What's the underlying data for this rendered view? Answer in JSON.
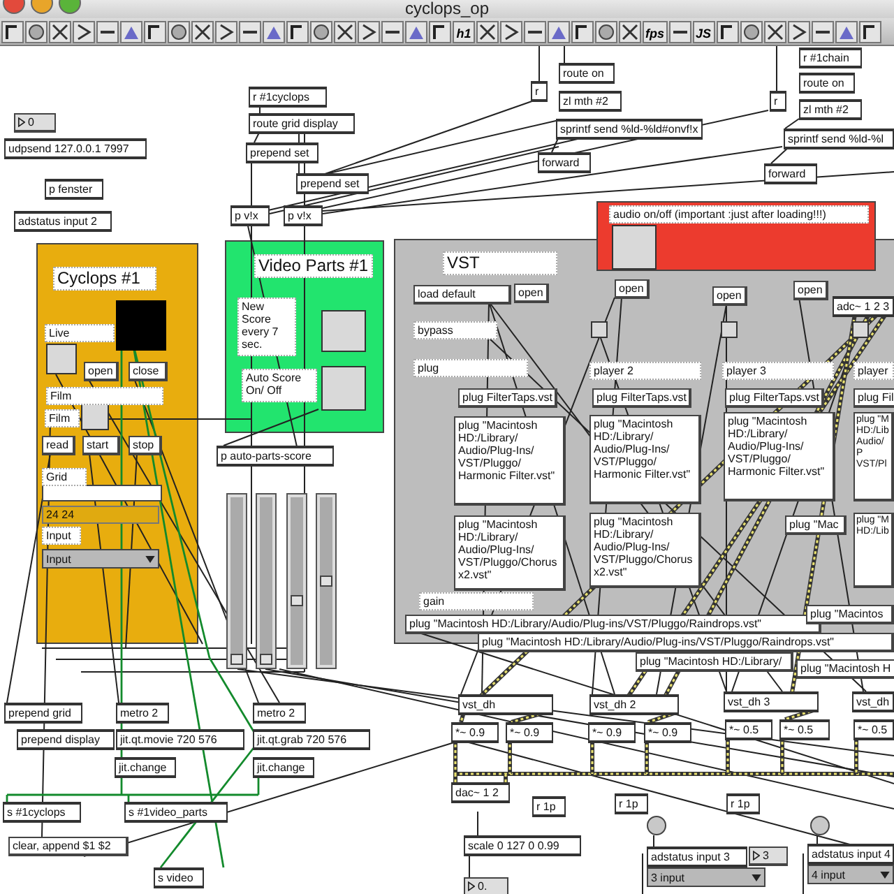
{
  "window": {
    "title": "cyclops_op"
  },
  "toolbar": {
    "labels": [
      "h1",
      "fps",
      "JS"
    ]
  },
  "panels": [
    {
      "color": "#e8ad0e"
    },
    {
      "color": "#22e46e"
    },
    {
      "color": "#bdbdbd"
    },
    {
      "color": "#ec3b2e"
    }
  ],
  "sliders": [
    {
      "level": 0.02
    },
    {
      "level": 0.02
    },
    {
      "level": 0.38
    },
    {
      "level": 0.5
    }
  ],
  "boxes": [
    {
      "kind": "number",
      "text": "0"
    },
    {
      "kind": "object",
      "text": "udpsend 127.0.0.1 7997"
    },
    {
      "kind": "object",
      "text": "p fenster"
    },
    {
      "kind": "object",
      "text": "adstatus input 2"
    },
    {
      "kind": "object",
      "text": "r #1cyclops"
    },
    {
      "kind": "object",
      "text": "route grid display"
    },
    {
      "kind": "object",
      "text": "prepend set"
    },
    {
      "kind": "object",
      "text": "prepend set"
    },
    {
      "kind": "object",
      "text": "p v!x"
    },
    {
      "kind": "object",
      "text": "p v!x"
    },
    {
      "kind": "object",
      "text": "route on"
    },
    {
      "kind": "object",
      "text": "r"
    },
    {
      "kind": "object",
      "text": "zl mth #2"
    },
    {
      "kind": "object",
      "text": "sprintf send %ld-%ld#onvf!x"
    },
    {
      "kind": "object",
      "text": "forward"
    },
    {
      "kind": "object",
      "text": "r"
    },
    {
      "kind": "object",
      "text": "r #1chain"
    },
    {
      "kind": "object",
      "text": "route on"
    },
    {
      "kind": "object",
      "text": "zl mth #2"
    },
    {
      "kind": "object",
      "text": "sprintf send %ld-%l"
    },
    {
      "kind": "object",
      "text": "forward"
    },
    {
      "kind": "comment",
      "text": "audio on/off (important :just after loading!!!)"
    },
    {
      "kind": "comment",
      "text": "Cyclops #1"
    },
    {
      "kind": "comment",
      "text": "Live"
    },
    {
      "kind": "message",
      "text": "open"
    },
    {
      "kind": "message",
      "text": "close"
    },
    {
      "kind": "comment",
      "text": "Film"
    },
    {
      "kind": "comment",
      "text": "Film"
    },
    {
      "kind": "message",
      "text": "read"
    },
    {
      "kind": "message",
      "text": "start"
    },
    {
      "kind": "message",
      "text": "stop"
    },
    {
      "kind": "comment",
      "text": "Grid"
    },
    {
      "kind": "display",
      "text": "24 24"
    },
    {
      "kind": "comment",
      "text": "Input"
    },
    {
      "kind": "menu",
      "text": "Input"
    },
    {
      "kind": "comment",
      "text": "Video Parts #1"
    },
    {
      "kind": "comment",
      "text": "New Score every 7 sec."
    },
    {
      "kind": "comment",
      "text": "Auto Score On/ Off"
    },
    {
      "kind": "object",
      "text": "p auto-parts-score"
    },
    {
      "kind": "comment",
      "text": "VST"
    },
    {
      "kind": "message",
      "text": "load default"
    },
    {
      "kind": "message",
      "text": "open"
    },
    {
      "kind": "message",
      "text": "open"
    },
    {
      "kind": "message",
      "text": "open"
    },
    {
      "kind": "message",
      "text": "open"
    },
    {
      "kind": "object",
      "text": "adc~ 1 2 3"
    },
    {
      "kind": "comment",
      "text": "bypass"
    },
    {
      "kind": "comment",
      "text": "plug"
    },
    {
      "kind": "comment",
      "text": "player 2"
    },
    {
      "kind": "comment",
      "text": "player 3"
    },
    {
      "kind": "comment",
      "text": "player"
    },
    {
      "kind": "message",
      "text": "plug FilterTaps.vst"
    },
    {
      "kind": "message",
      "text": "plug FilterTaps.vst"
    },
    {
      "kind": "message",
      "text": "plug FilterTaps.vst"
    },
    {
      "kind": "message",
      "text": "plug Fil"
    },
    {
      "kind": "message",
      "text": "plug \"Macintosh HD:/Library/ Audio/Plug-Ins/ VST/Pluggo/ Harmonic Filter.vst\""
    },
    {
      "kind": "message",
      "text": "plug \"Macintosh HD:/Library/ Audio/Plug-Ins/ VST/Pluggo/ Harmonic Filter.vst\""
    },
    {
      "kind": "message",
      "text": "plug \"Macintosh HD:/Library/ Audio/Plug-Ins/ VST/Pluggo/ Harmonic Filter.vst\""
    },
    {
      "kind": "message",
      "text": "plug \"M HD:/Lib Audio/P VST/Pl"
    },
    {
      "kind": "message",
      "text": "plug \"Macintosh HD:/Library/ Audio/Plug-Ins/ VST/Pluggo/Chorus x2.vst\""
    },
    {
      "kind": "message",
      "text": "plug \"Macintosh HD:/Library/ Audio/Plug-Ins/ VST/Pluggo/Chorus x2.vst\""
    },
    {
      "kind": "message",
      "text": "plug \"Mac"
    },
    {
      "kind": "message",
      "text": "plug \"M HD:/Lib"
    },
    {
      "kind": "comment",
      "text": "gain"
    },
    {
      "kind": "message",
      "text": "plug \"Macintosh HD:/Library/Audio/Plug-ins/VST/Pluggo/Raindrops.vst\""
    },
    {
      "kind": "message",
      "text": "plug \"Macintos"
    },
    {
      "kind": "message",
      "text": "plug \"Macintosh HD:/Library/Audio/Plug-ins/VST/Pluggo/Raindrops.vst\""
    },
    {
      "kind": "message",
      "text": "plug \"Macintosh HD:/Library/"
    },
    {
      "kind": "message",
      "text": "plug \"Macintosh H"
    },
    {
      "kind": "object",
      "text": "vst_dh"
    },
    {
      "kind": "object",
      "text": "vst_dh 2"
    },
    {
      "kind": "object",
      "text": "vst_dh 3"
    },
    {
      "kind": "object",
      "text": "vst_dh"
    },
    {
      "kind": "object",
      "text": "*~ 0.9"
    },
    {
      "kind": "object",
      "text": "*~ 0.9"
    },
    {
      "kind": "object",
      "text": "*~ 0.9"
    },
    {
      "kind": "object",
      "text": "*~ 0.9"
    },
    {
      "kind": "object",
      "text": "*~ 0.5"
    },
    {
      "kind": "object",
      "text": "*~ 0.5"
    },
    {
      "kind": "object",
      "text": "*~ 0.5"
    },
    {
      "kind": "object",
      "text": "dac~ 1 2"
    },
    {
      "kind": "object",
      "text": "r 1p"
    },
    {
      "kind": "object",
      "text": "r 1p"
    },
    {
      "kind": "object",
      "text": "r 1p"
    },
    {
      "kind": "object",
      "text": "scale 0 127 0 0.99"
    },
    {
      "kind": "number",
      "text": "0."
    },
    {
      "kind": "object",
      "text": "adstatus input 3"
    },
    {
      "kind": "number",
      "text": "3"
    },
    {
      "kind": "menu",
      "text": "3 input"
    },
    {
      "kind": "object",
      "text": "adstatus input 4"
    },
    {
      "kind": "menu",
      "text": "4 input"
    },
    {
      "kind": "object",
      "text": "prepend grid"
    },
    {
      "kind": "object",
      "text": "prepend display"
    },
    {
      "kind": "object",
      "text": "metro 2"
    },
    {
      "kind": "object",
      "text": "jit.qt.movie 720 576"
    },
    {
      "kind": "object",
      "text": "jit.change"
    },
    {
      "kind": "object",
      "text": "metro 2"
    },
    {
      "kind": "object",
      "text": "jit.qt.grab 720 576"
    },
    {
      "kind": "object",
      "text": "jit.change"
    },
    {
      "kind": "object",
      "text": "s #1cyclops"
    },
    {
      "kind": "object",
      "text": "s #1video_parts"
    },
    {
      "kind": "message",
      "text": "clear, append $1 $2"
    },
    {
      "kind": "object",
      "text": "s video"
    }
  ]
}
